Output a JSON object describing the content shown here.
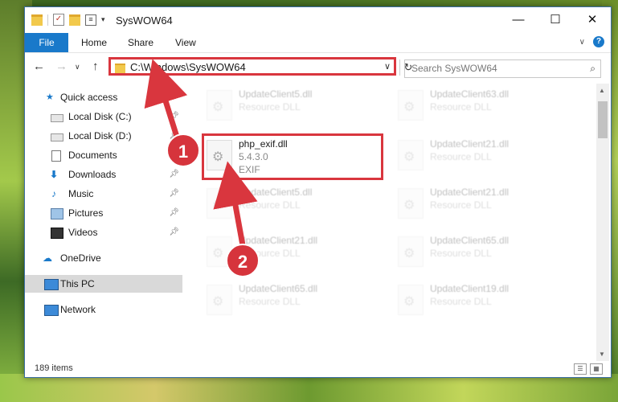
{
  "window": {
    "title": "SysWOW64",
    "minimize": "—",
    "maximize": "☐",
    "close": "✕"
  },
  "ribbon": {
    "file": "File",
    "home": "Home",
    "share": "Share",
    "view": "View",
    "help": "?"
  },
  "nav": {
    "address": "C:\\Windows\\SysWOW64",
    "search_placeholder": "Search SysWOW64"
  },
  "sidebar": {
    "items": [
      {
        "label": "Quick access",
        "icon": "star-icon",
        "pinned": false
      },
      {
        "label": "Local Disk (C:)",
        "icon": "drive-icon",
        "pinned": true
      },
      {
        "label": "Local Disk (D:)",
        "icon": "drive-icon",
        "pinned": true
      },
      {
        "label": "Documents",
        "icon": "documents-icon",
        "pinned": true
      },
      {
        "label": "Downloads",
        "icon": "download-icon",
        "pinned": true
      },
      {
        "label": "Music",
        "icon": "music-icon",
        "pinned": true
      },
      {
        "label": "Pictures",
        "icon": "pictures-icon",
        "pinned": true
      },
      {
        "label": "Videos",
        "icon": "videos-icon",
        "pinned": true
      },
      {
        "label": "OneDrive",
        "icon": "cloud-icon",
        "pinned": false
      },
      {
        "label": "This PC",
        "icon": "computer-icon",
        "pinned": false
      },
      {
        "label": "Network",
        "icon": "network-icon",
        "pinned": false
      }
    ]
  },
  "files": {
    "left": [
      {
        "name": "UpdateClient5.dll",
        "type": "Resource DLL"
      },
      {
        "name": "php_exif.dll",
        "version": "5.4.3.0",
        "desc": "EXIF"
      },
      {
        "name": "UpdateClient5.dll",
        "type": "Resource DLL"
      },
      {
        "name": "UpdateClient21.dll",
        "type": "Resource DLL"
      },
      {
        "name": "UpdateClient65.dll",
        "type": "Resource DLL"
      }
    ],
    "right": [
      {
        "name": "UpdateClient63.dll",
        "type": "Resource DLL"
      },
      {
        "name": "UpdateClient21.dll",
        "type": "Resource DLL"
      },
      {
        "name": "UpdateClient21.dll",
        "type": "Resource DLL"
      },
      {
        "name": "UpdateClient65.dll",
        "type": "Resource DLL"
      },
      {
        "name": "UpdateClient19.dll",
        "type": "Resource DLL"
      }
    ]
  },
  "status": {
    "count": "189 items"
  },
  "annotations": {
    "badge1": "1",
    "badge2": "2",
    "color": "#d9363e"
  }
}
